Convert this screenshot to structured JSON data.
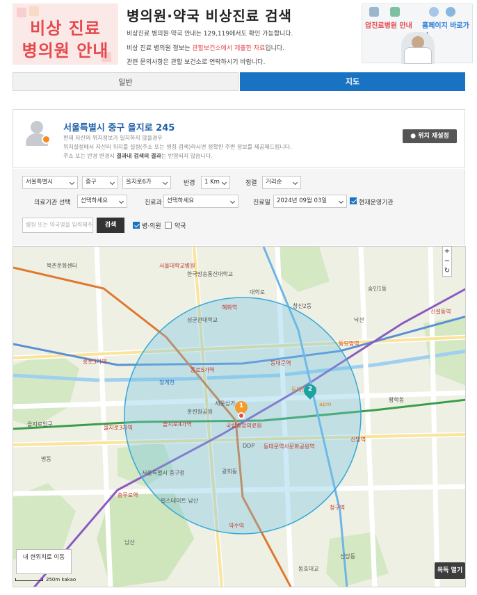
{
  "header": {
    "logo_line1": "비상 진료",
    "logo_line2": "병의원 안내",
    "title": "병의원·약국 비상진료 검색",
    "desc1": "비상진료 병의원·약국 안내는 129,119에서도 확인 가능합니다.",
    "desc2_pre": "비상 진료 병의원 정보는 ",
    "desc2_hl": "관할보건소에서 제출한 자료",
    "desc2_post": "입니다.",
    "desc3": "관련 문의사항은 관할 보건소로 연락하시기 바랍니다.",
    "banner_left": "압진료병원 안내",
    "banner_right": "홈페이지 바로가기"
  },
  "tabs": [
    {
      "label": "일반",
      "active": false
    },
    {
      "label": "지도",
      "active": true
    }
  ],
  "location": {
    "address": "서울특별시 중구 을지로 245",
    "line1": "현재 자신의 위치정보가 일치하지 않을경우",
    "line2": "위치설정에서 자신의 위치를 설정(주소 또는 명칭 검색)하시면 정확한 주변 정보를 제공해드립니다.",
    "line3_pre": "주소 또는 반경 변경시 ",
    "line3_bold": "결과내 검색의 결과",
    "line3_post": "는 반영되지 않습니다.",
    "reset_label": "위치 재설정"
  },
  "filters": {
    "sido": "서울특별시",
    "gu": "중구",
    "dong": "을지로6가",
    "radius_label": "반경",
    "radius": "1 Km",
    "sort_label": "정렬",
    "sort": "거리순",
    "type_label": "의료기관 선택",
    "type_value": "선택하세요",
    "dept_label": "진료과",
    "dept_value": "선택하세요",
    "date_label": "진료일",
    "date_value": "2024년 09월 03일",
    "open_now_label": "현재운영기관",
    "open_now": true,
    "search_placeholder": "병원 또는 약국명을 입력해주세요",
    "search_button": "검색",
    "hospital_label": "병·의원",
    "hospital_checked": true,
    "pharmacy_label": "약국",
    "pharmacy_checked": false
  },
  "map": {
    "zoom_in": "+",
    "zoom_out": "−",
    "refresh": "↻",
    "my_location": "내 현위치로 이동",
    "scale": "250m",
    "provider": "kakao",
    "overlay_button": "옥독 열기",
    "markers": [
      {
        "number": "1",
        "color": "#f39c2c"
      },
      {
        "number": "2",
        "color": "#1ba3a0"
      }
    ],
    "labels": [
      "북촌문화센터",
      "서울대학교병원",
      "한국방송통신대학교",
      "낙산",
      "대학로",
      "혜화역",
      "성균관대학교",
      "창신2동",
      "종로3가역",
      "종로5가역",
      "동대문역",
      "동묘앞역",
      "신설동역",
      "숭인1동",
      "청계천",
      "을지로3가역",
      "을지로4가역",
      "을지로입구",
      "국립중앙의료원",
      "동대문역사문화공원역",
      "신당역",
      "황학동",
      "광희동",
      "충무로역",
      "명동",
      "서울특별시 중구청",
      "남산",
      "필스테이트 남산",
      "약수역",
      "청구역",
      "신당동",
      "DDP",
      "훈련원공원",
      "동대문시장",
      "apm",
      "세운상가",
      "동호대교"
    ]
  }
}
